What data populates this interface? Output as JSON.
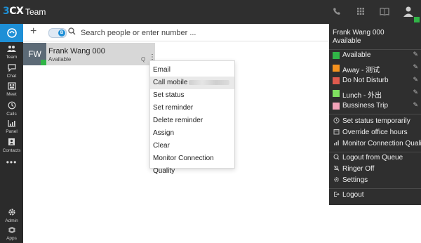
{
  "topbar": {
    "logo_num": "3",
    "logo_text": "CX",
    "title": "Team",
    "icons": [
      "phone-icon",
      "dialpad-icon",
      "address-book-icon",
      "user-avatar-icon"
    ]
  },
  "leftnav": {
    "items": [
      {
        "label": "Team",
        "icon": "team-icon"
      },
      {
        "label": "Chat",
        "icon": "chat-icon"
      },
      {
        "label": "Meet",
        "icon": "meet-icon"
      },
      {
        "label": "Calls",
        "icon": "calls-history-icon"
      },
      {
        "label": "Panel",
        "icon": "panel-icon"
      },
      {
        "label": "Contacts",
        "icon": "contacts-icon"
      },
      {
        "label": "Admin",
        "icon": "gear-icon"
      },
      {
        "label": "Apps",
        "icon": "apps-icon"
      }
    ],
    "more": "•••"
  },
  "toolbar": {
    "add_label": "+",
    "toggle_label": "B",
    "search_placeholder": "Search people or enter number ..."
  },
  "contact_card": {
    "initials": "FW",
    "name": "Frank Wang 000",
    "status": "Available",
    "queue_marker": "Q",
    "menu_marker": "⋮"
  },
  "context_menu": {
    "items": [
      "Email",
      "Call mobile",
      "Set status",
      "Set reminder",
      "Delete reminder",
      "Assign",
      "Clear",
      "Monitor Connection Quality"
    ]
  },
  "status_panel": {
    "user_name": "Frank Wang  000",
    "user_status": "Available",
    "statuses": [
      {
        "label": "Available",
        "color": "#31b447"
      },
      {
        "label": "Away - 测试",
        "color": "#f5921e"
      },
      {
        "label": "Do Not Disturb",
        "color": "#e05a4e"
      },
      {
        "label": "Lunch - 外出",
        "color": "#80e060"
      },
      {
        "label": "Bussiness Trip",
        "color": "#f2a3b8"
      }
    ],
    "options": [
      "Set status temporarily",
      "Override office hours",
      "Monitor Connection Quality"
    ],
    "queue_options": [
      "Logout from Queue",
      "Ringer Off",
      "Settings"
    ],
    "logout": "Logout"
  },
  "colors": {
    "accent": "#1e8fd6",
    "available": "#31b447",
    "topbar": "#2f2f2f"
  }
}
